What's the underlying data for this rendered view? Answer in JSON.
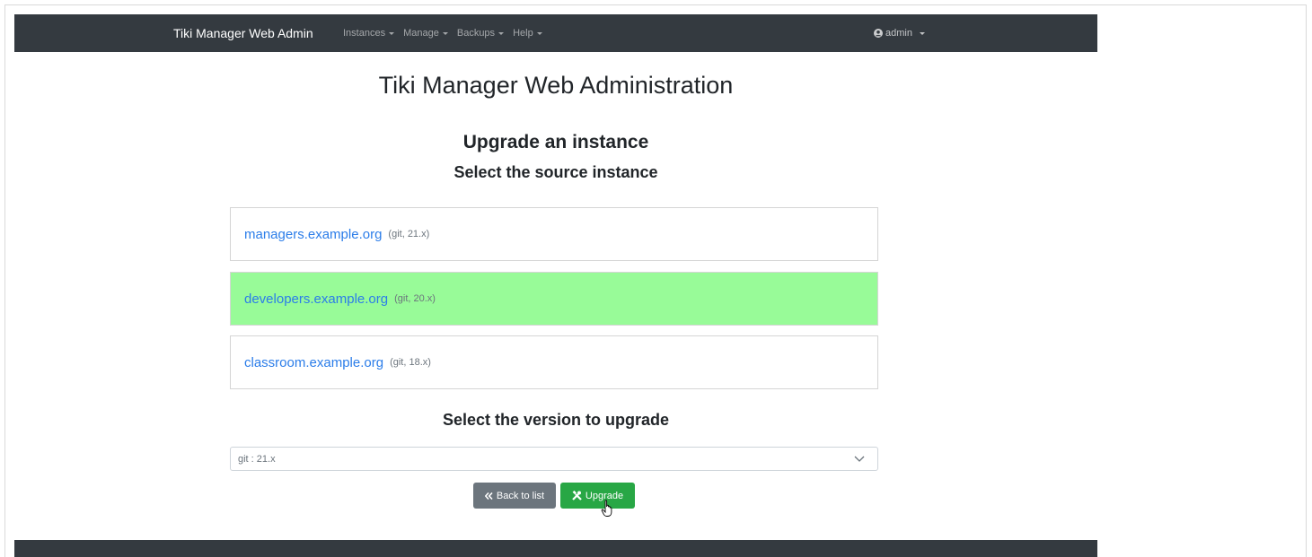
{
  "navbar": {
    "brand": "Tiki Manager Web Admin",
    "items": [
      {
        "label": "Instances"
      },
      {
        "label": "Manage"
      },
      {
        "label": "Backups"
      },
      {
        "label": "Help"
      }
    ],
    "user": {
      "label": "admin",
      "icon": "user-circle-icon"
    }
  },
  "main": {
    "title": "Tiki Manager Web Administration",
    "section_title": "Upgrade an instance",
    "section_subtitle": "Select the source instance",
    "instances": [
      {
        "name": "managers.example.org",
        "meta": "(git, 21.x)",
        "selected": false
      },
      {
        "name": "developers.example.org",
        "meta": "(git, 20.x)",
        "selected": true
      },
      {
        "name": "classroom.example.org",
        "meta": "(git, 18.x)",
        "selected": false
      }
    ],
    "version_title": "Select the version to upgrade",
    "version_select": {
      "value": "git : 21.x",
      "icon": "chevron-down-icon"
    },
    "buttons": {
      "back": {
        "label": "Back to list",
        "icon": "double-chevron-left-icon"
      },
      "upgrade": {
        "label": "Upgrade",
        "icon": "tools-icon"
      }
    }
  },
  "colors": {
    "navbar": "#343a40",
    "selected_row": "#98fb98",
    "link": "#2b7de9",
    "back_button": "#6c757d",
    "upgrade_button": "#28a745"
  }
}
